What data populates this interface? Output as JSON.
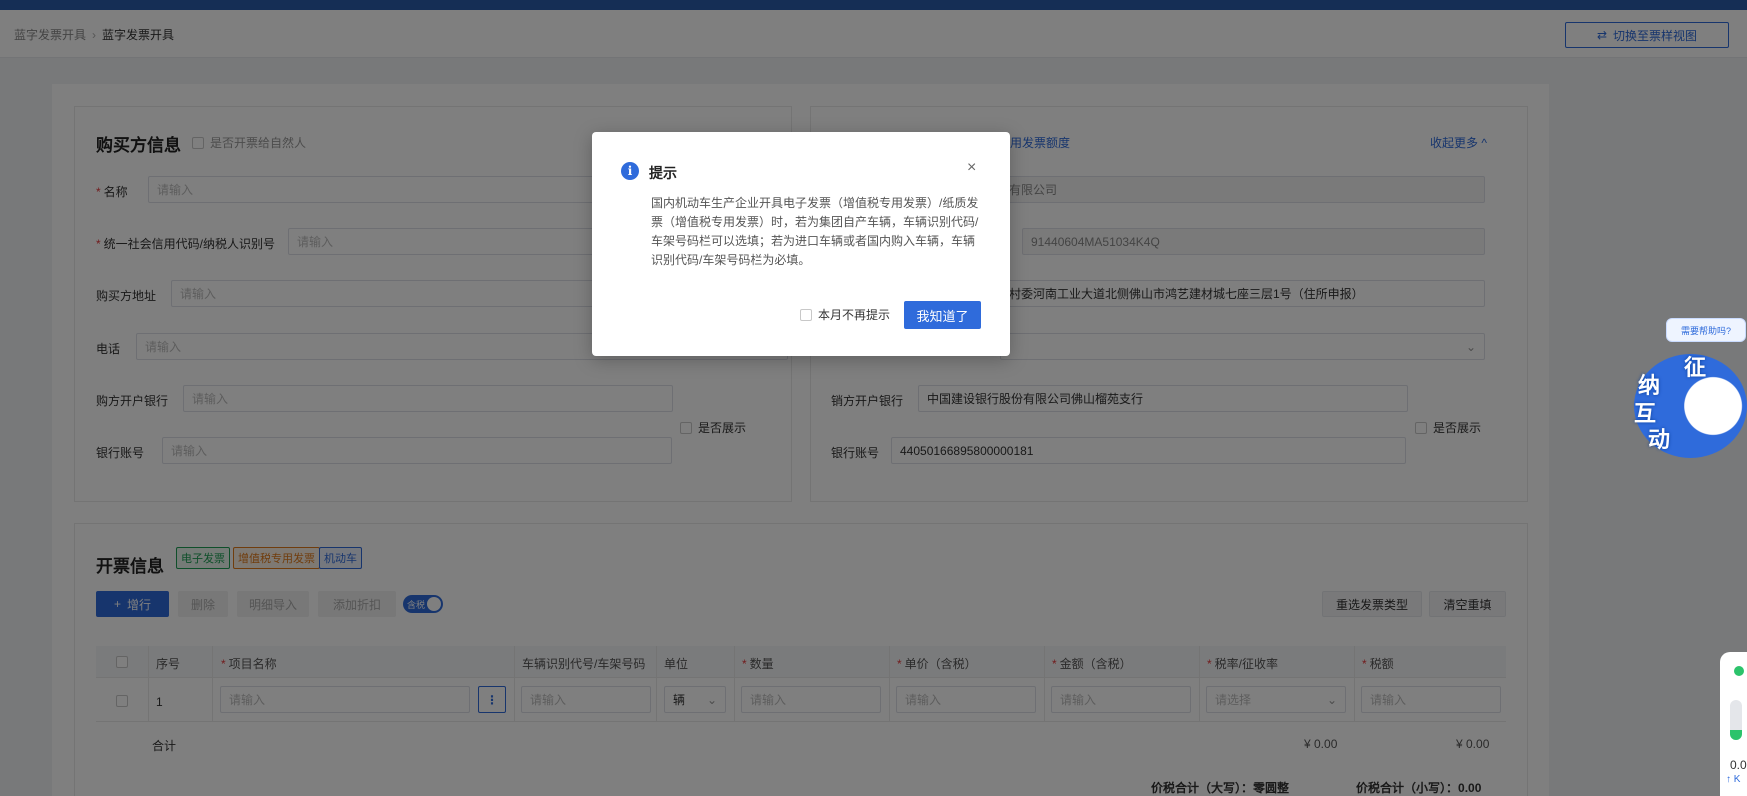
{
  "breadcrumb": {
    "parent": "蓝字发票开具",
    "current": "蓝字发票开具"
  },
  "header": {
    "switch_button": "切换至票样视图"
  },
  "buyer": {
    "title": "购买方信息",
    "natural_person": "是否开票给自然人",
    "name_label": "名称",
    "name_placeholder": "请输入",
    "taxid_label": "统一社会信用代码/纳税人识别号",
    "taxid_placeholder": "请输入",
    "address_label": "购买方地址",
    "address_placeholder": "请输入",
    "phone_label": "电话",
    "phone_placeholder": "请输入",
    "bank_label": "购方开户银行",
    "bank_placeholder": "请输入",
    "show_label": "是否展示",
    "account_label": "银行账号",
    "account_placeholder": "请输入"
  },
  "seller": {
    "quota_link": "用发票额度",
    "collapse_link": "收起更多 ^",
    "name_value": "有限公司",
    "taxid_value": "91440604MA51034K4Q",
    "address_value": "村委河南工业大道北侧佛山市鸿艺建材城七座三层1号（住所申报）",
    "bank_label": "销方开户银行",
    "bank_value": "中国建设银行股份有限公司佛山榴苑支行",
    "show_label": "是否展示",
    "account_label": "银行账号",
    "account_value": "44050166895800000181"
  },
  "invoice": {
    "title": "开票信息",
    "tags": [
      "电子发票",
      "增值税专用发票",
      "机动车"
    ],
    "add_row": "增行",
    "delete": "删除",
    "import_detail": "明细导入",
    "add_discount": "添加折扣",
    "tax_toggle": "含税",
    "reselect": "重选发票类型",
    "clear": "清空重填",
    "columns": [
      "序号",
      "项目名称",
      "车辆识别代号/车架号码",
      "单位",
      "数量",
      "单价（含税）",
      "金额（含税）",
      "税率/征收率",
      "税额"
    ],
    "row": {
      "index": "1",
      "name_placeholder": "请输入",
      "vin_placeholder": "请输入",
      "unit": "辆",
      "qty_placeholder": "请输入",
      "price_placeholder": "请输入",
      "amount_placeholder": "请输入",
      "rate_placeholder": "请选择",
      "tax_placeholder": "请输入"
    },
    "total_label": "合计",
    "total_amount": "¥ 0.00",
    "total_tax": "¥ 0.00",
    "grand_upper_label": "价税合计（大写）：",
    "grand_upper_value": "零圆整",
    "grand_lower_label": "价税合计（小写）：",
    "grand_lower_value": "0.00"
  },
  "modal": {
    "title": "提示",
    "close": "×",
    "body": "国内机动车生产企业开具电子发票（增值税专用发票）/纸质发票（增值税专用发票）时，若为集团自产车辆，车辆识别代码/车架号码栏可以选填；若为进口车辆或者国内购入车辆，车辆识别代码/车架号码栏为必填。",
    "no_remind": "本月不再提示",
    "ok": "我知道了"
  },
  "helper": {
    "bubble": "需要帮助吗?",
    "chars": [
      "征",
      "纳",
      "互",
      "动"
    ]
  },
  "side_widget": {
    "value": "0.0",
    "unit": "K"
  },
  "colors": {
    "primary": "#2f6bdb",
    "topbar": "#2a5caa",
    "required": "#e4393c"
  }
}
